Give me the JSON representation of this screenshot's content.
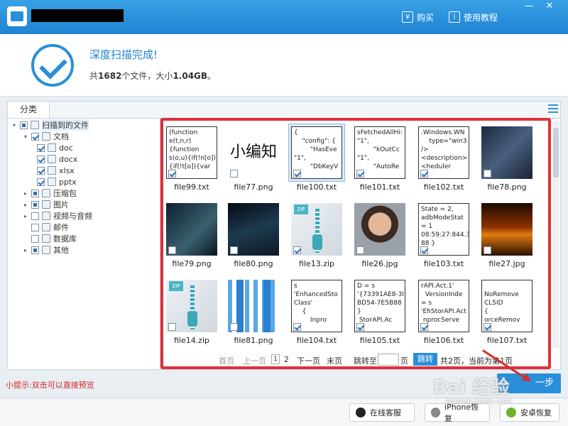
{
  "titlebar": {
    "buy_label": "购买",
    "tutorial_label": "使用教程",
    "minimize_label": "—",
    "close_label": "✕"
  },
  "summary": {
    "title": "深度扫描完成!",
    "prefix": "共",
    "file_count": "1682",
    "mid": "个文件，大小",
    "size": "1.04GB",
    "suffix": "。"
  },
  "tabs": {
    "classify": "分类"
  },
  "tree": {
    "root": "扫描到的文件",
    "items": [
      {
        "label": "文档"
      },
      {
        "label": "doc"
      },
      {
        "label": "docx"
      },
      {
        "label": "xlsx"
      },
      {
        "label": "pptx"
      },
      {
        "label": "压缩包"
      },
      {
        "label": "图片"
      },
      {
        "label": "视频与音频"
      },
      {
        "label": "邮件"
      },
      {
        "label": "数据库"
      },
      {
        "label": "其他"
      }
    ]
  },
  "files": [
    {
      "name": "file99.txt",
      "preview": "(function\ne(t,n,r)\n{function\ns(o,u){if(!n[o])\n{if(!t[o]){var"
    },
    {
      "name": "file77.png",
      "preview": "小编知"
    },
    {
      "name": "file100.txt",
      "preview": "{\n    \"config\": {\n        \"HasEve\n\"1\",\n        \"DbKeyV"
    },
    {
      "name": "file101.txt",
      "preview": "sFetchedAllHi:\n\"1\",\n        \"kOutCc\n\"1\",\n        \"AutoRe"
    },
    {
      "name": "file102.txt",
      "preview": ".Windows.WN\n    type=\"win3\n/>\n<description>\n<heduler"
    },
    {
      "name": "file78.png",
      "preview": ""
    },
    {
      "name": "file79.png",
      "preview": ""
    },
    {
      "name": "file80.png",
      "preview": ""
    },
    {
      "name": "file13.zip",
      "preview": "ZIP"
    },
    {
      "name": "file26.jpg",
      "preview": ""
    },
    {
      "name": "file103.txt",
      "preview": "State = 2,\nadbModeStat\n= 1\n08:59:27:844.3\n88 }"
    },
    {
      "name": "file27.jpg",
      "preview": ""
    },
    {
      "name": "file14.zip",
      "preview": "ZIP"
    },
    {
      "name": "file81.png",
      "preview": ""
    },
    {
      "name": "file104.txt",
      "preview": "s\n'EnhancedSto\nClass'\n    {\n        Inpro"
    },
    {
      "name": "file105.txt",
      "preview": "D = s\n'{73391AE8-3I\nBD54-7E5B88\n}\n StorAPI.Ac"
    },
    {
      "name": "file106.txt",
      "preview": "rAPI.Act.1'\n  VersionInde\n= s\n'EhStorAPI.Act\n nprocServe"
    },
    {
      "name": "file107.txt",
      "preview": "\nNoRemove\nCLSID\n{\norceRemov"
    }
  ],
  "pager": {
    "first": "首页",
    "prev": "上一页",
    "page1": "1",
    "page2": "2",
    "next": "下一页",
    "last": "末页",
    "jump_to": "跳转至",
    "page_unit": "页",
    "jump_btn": "跳转",
    "status": "共2页，当前为第1页"
  },
  "tip": "小提示:双击可以直接预览",
  "next_step": "一步",
  "footer": {
    "online_service": "在线客服",
    "iphone_recover": "iPhone恢复",
    "android_recover": "安卓恢复"
  },
  "watermark": {
    "main": "Bai 经验",
    "sub": "jingyan.baidu.com"
  },
  "colors": {
    "accent": "#2a8fd8",
    "highlight_frame": "#e0303a",
    "tip_text": "#d62424"
  }
}
